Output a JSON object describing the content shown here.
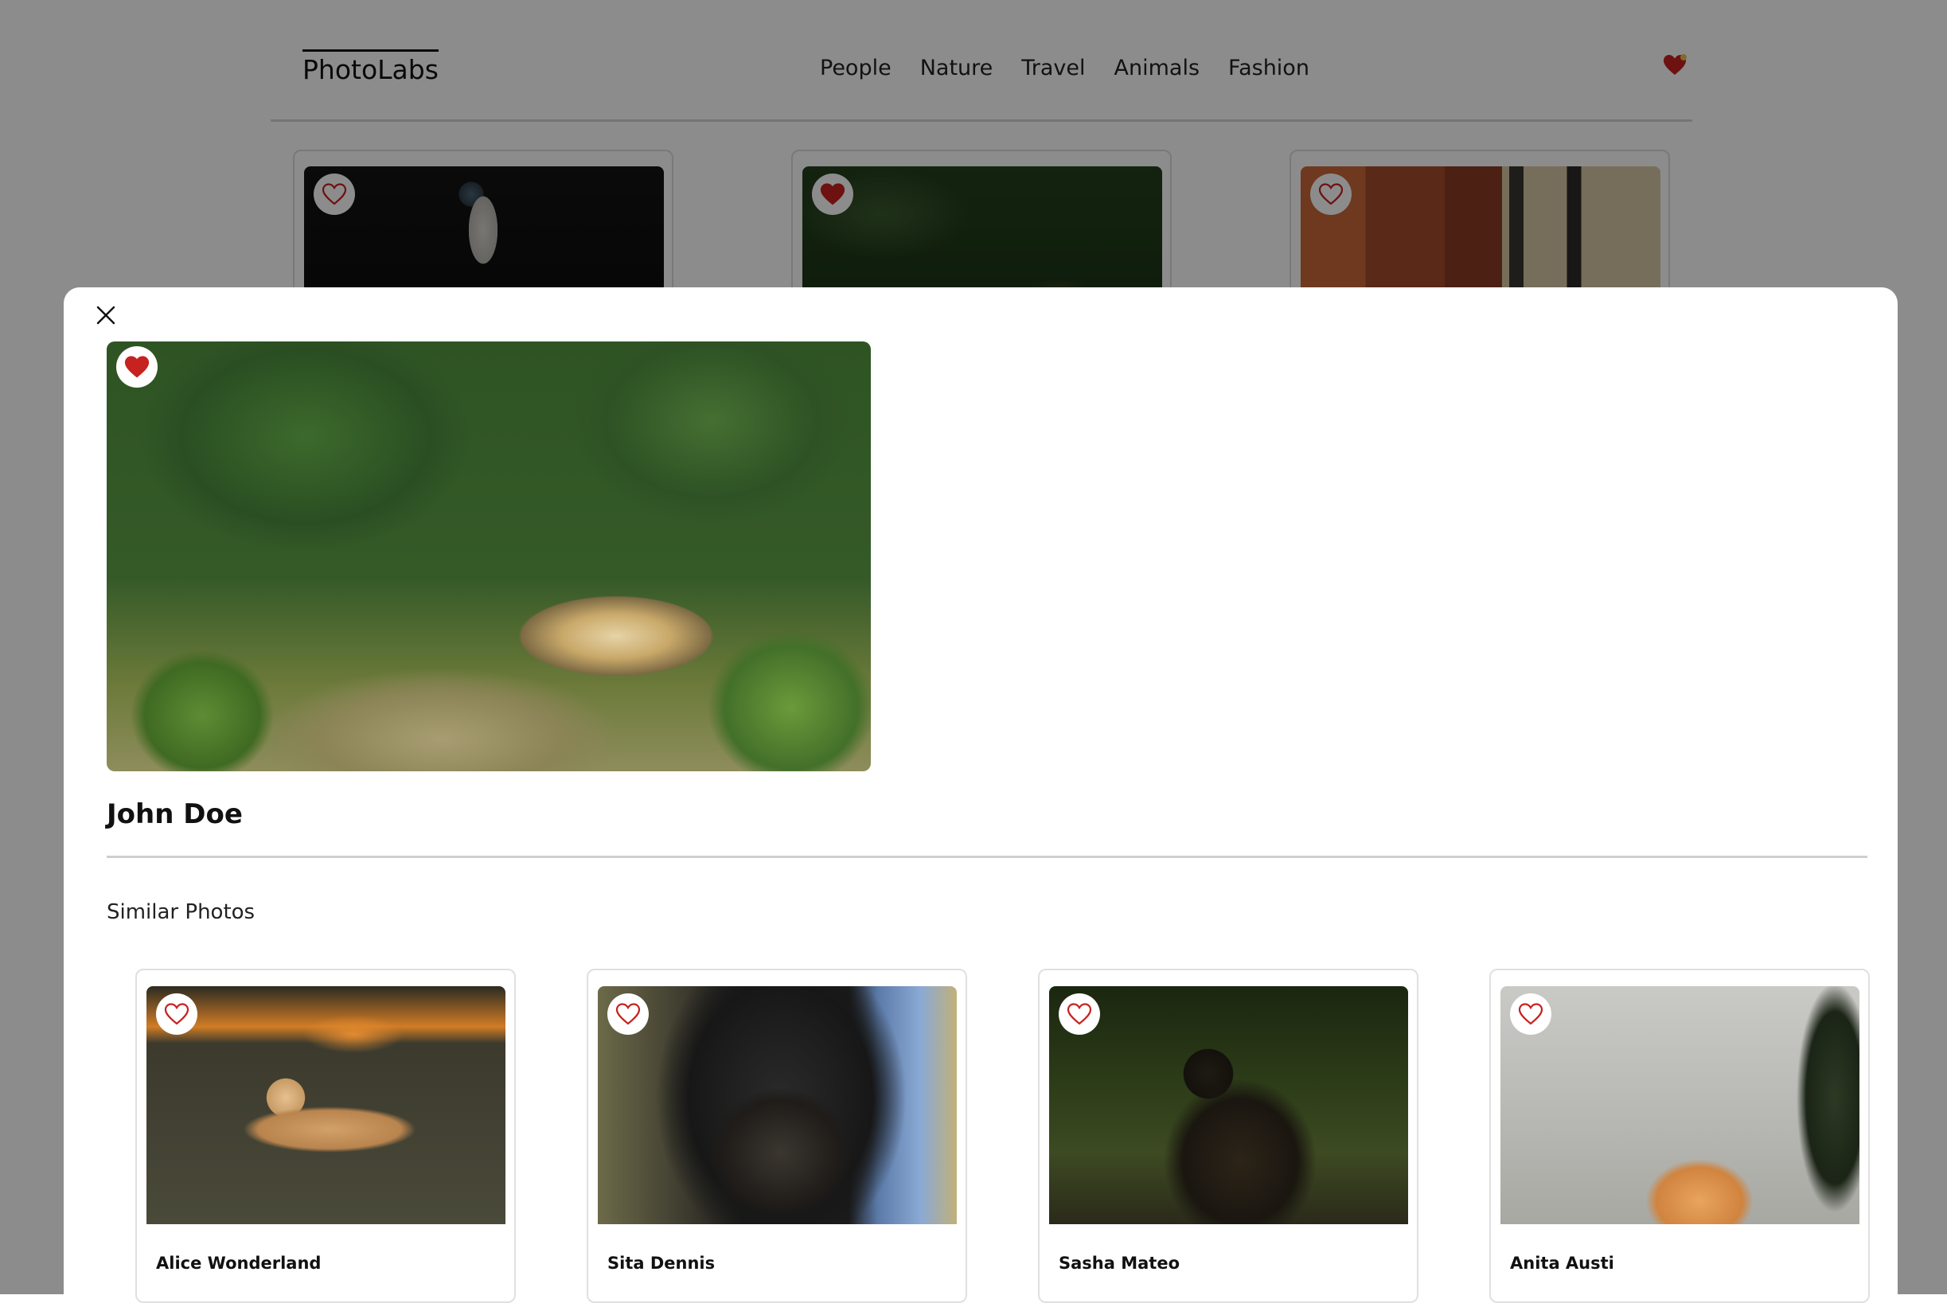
{
  "nav": {
    "logo": "PhotoLabs",
    "topics": [
      "People",
      "Nature",
      "Travel",
      "Animals",
      "Fashion"
    ]
  },
  "background_grid": {
    "cards": [
      {
        "favourited": false
      },
      {
        "favourited": true
      },
      {
        "favourited": false
      }
    ]
  },
  "modal": {
    "photo": {
      "favourited": true
    },
    "photographer": "John Doe",
    "similar_title": "Similar Photos",
    "similar": [
      {
        "name": "Alice Wonderland",
        "favourited": false
      },
      {
        "name": "Sita Dennis",
        "favourited": false
      },
      {
        "name": "Sasha Mateo",
        "favourited": false
      },
      {
        "name": "Anita Austi",
        "favourited": false
      }
    ]
  },
  "colors": {
    "heart": "#C6221F",
    "overlay": "rgba(0,0,0,0.45)",
    "card_border": "#e0e0e0"
  },
  "icons": {
    "close": "close-icon",
    "fav_badge": "heart-icon",
    "fav_button": "heart-icon"
  }
}
